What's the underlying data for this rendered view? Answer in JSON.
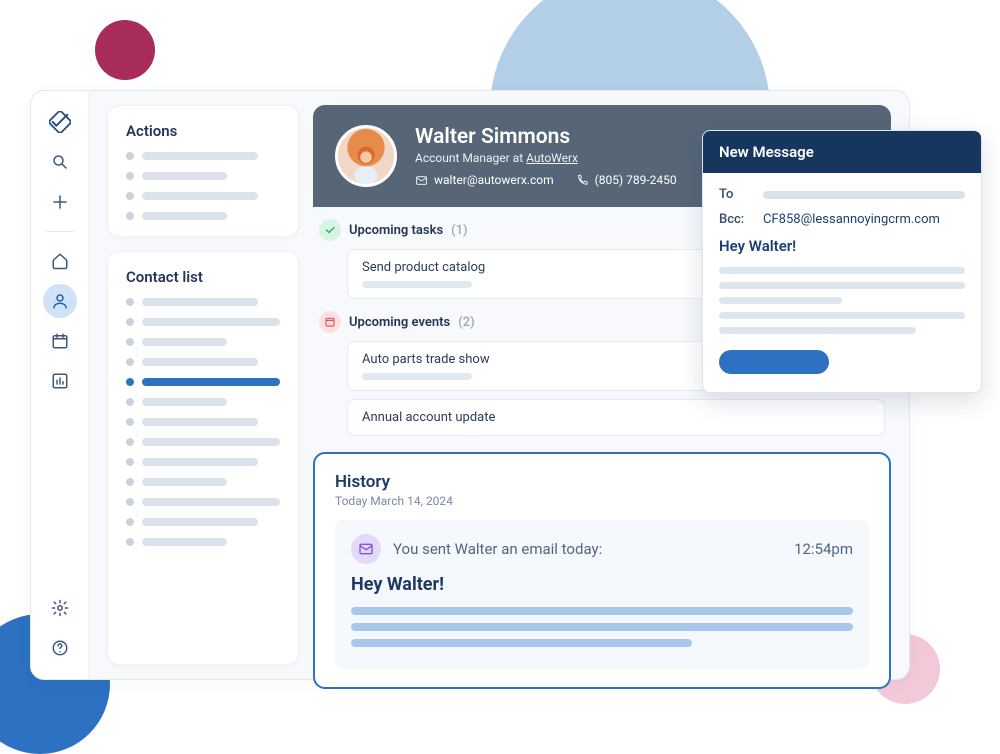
{
  "panels": {
    "actions": {
      "title": "Actions"
    },
    "contact_list": {
      "title": "Contact list"
    }
  },
  "contact": {
    "name": "Walter Simmons",
    "role": "Account Manager at ",
    "company": "AutoWerx",
    "email": "walter@autowerx.com",
    "phone": "(805) 789-2450"
  },
  "sections": {
    "tasks": {
      "label": "Upcoming tasks",
      "count": "(1)",
      "items": [
        "Send product catalog"
      ]
    },
    "events": {
      "label": "Upcoming events",
      "count": "(2)",
      "items": [
        "Auto parts trade show",
        "Annual account update"
      ]
    }
  },
  "history": {
    "title": "History",
    "date": "Today March 14, 2024",
    "entry_text": "You sent  Walter an email today:",
    "entry_time": "12:54pm",
    "entry_subject": "Hey Walter!"
  },
  "new_message": {
    "title": "New Message",
    "to_label": "To",
    "bcc_label": "Bcc:",
    "bcc_value": "CF858@lessannoyingcrm.com",
    "greeting": "Hey Walter!"
  }
}
